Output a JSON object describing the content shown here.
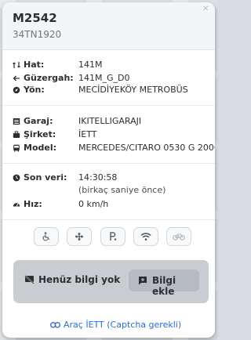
{
  "vehicle": {
    "code": "M2542",
    "plate": "34TN1920"
  },
  "route": [
    {
      "label": "Hat:",
      "value": "141M",
      "icon": "route-icon"
    },
    {
      "label": "Güzergah:",
      "value": "141M_G_D0",
      "icon": "arrow-left-icon"
    },
    {
      "label": "Yön:",
      "value": "MECİDİYEKÖY METROBÜS",
      "icon": "compass-icon"
    }
  ],
  "details": [
    {
      "label": "Garaj:",
      "value": "IKITELLIGARAJI",
      "icon": "garage-icon"
    },
    {
      "label": "Şirket:",
      "value": "İETT",
      "icon": "briefcase-icon"
    },
    {
      "label": "Model:",
      "value": "MERCEDES/CITARO 0530 G 2006",
      "icon": "bus-icon"
    }
  ],
  "status": {
    "last_data_label": "Son veri:",
    "last_data_time": "14:30:58",
    "last_data_relative": "(birkaç saniye önce)",
    "speed_label": "Hız:",
    "speed_value": "0 km/h"
  },
  "features": [
    "wheelchair-icon",
    "fan-icon",
    "accessible-parking-icon",
    "wifi-icon",
    "bicycle-icon"
  ],
  "info": {
    "no_info": "Henüz bilgi yok",
    "add_info": "Bilgi ekle"
  },
  "link": {
    "text": "Araç İETT (Captcha gerekli)"
  },
  "colors": {
    "link": "#2f6bd0",
    "info_bg": "#c9ccd0",
    "accent_dark": "#2b2f33"
  }
}
